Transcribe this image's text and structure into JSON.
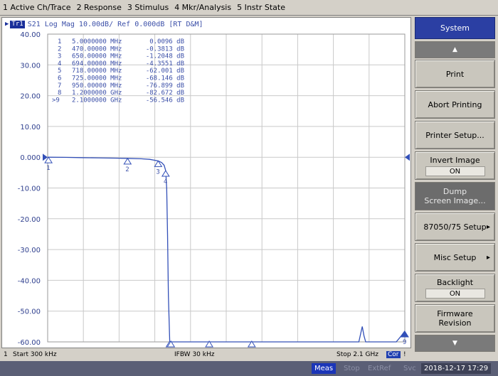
{
  "menu": [
    "1 Active Ch/Trace",
    "2 Response",
    "3 Stimulus",
    "4 Mkr/Analysis",
    "5 Instr State"
  ],
  "trace": {
    "badge": "Tr1",
    "header": "S21  Log Mag 10.00dB/ Ref 0.000dB [RT D&M]"
  },
  "chart_data": {
    "type": "line",
    "xlabel": "",
    "ylabel": "",
    "x_unit": "GHz",
    "xlim": [
      0.0003,
      2.1
    ],
    "ylim": [
      -60,
      40
    ],
    "yticks": [
      "40.00",
      "30.00",
      "20.00",
      "10.00",
      "0.000",
      "-10.00",
      "-20.00",
      "-30.00",
      "-40.00",
      "-50.00",
      "-60.00"
    ],
    "grid": true,
    "series": [
      {
        "x": [
          0.0003,
          0.005,
          0.1,
          0.2,
          0.3,
          0.4,
          0.47,
          0.55,
          0.6,
          0.65,
          0.67,
          0.685,
          0.694,
          0.7,
          0.705,
          0.71,
          0.718,
          0.725,
          0.73,
          0.735,
          0.95,
          1.2,
          1.5,
          1.7,
          1.8,
          1.83,
          1.85,
          1.86,
          1.87,
          1.9,
          2.0,
          2.05,
          2.08,
          2.1
        ],
        "y": [
          0.0,
          0.0,
          -0.05,
          -0.15,
          -0.2,
          -0.3,
          -0.38,
          -0.5,
          -0.7,
          -1.2,
          -1.7,
          -2.6,
          -4.36,
          -10,
          -25,
          -45,
          -62.0,
          -68.1,
          -70,
          -70,
          -76.9,
          -82.7,
          -80,
          -78,
          -72,
          -63,
          -55,
          -58,
          -70,
          -65,
          -61,
          -60,
          -58,
          -56.5
        ]
      }
    ],
    "markers": [
      {
        "n": "1",
        "active": false,
        "freq": "5.0000000 MHz",
        "val": "0.0096 dB",
        "x": 0.005,
        "y": 0.0096
      },
      {
        "n": "2",
        "active": false,
        "freq": "470.00000 MHz",
        "val": "-0.3813 dB",
        "x": 0.47,
        "y": -0.3813
      },
      {
        "n": "3",
        "active": false,
        "freq": "650.00000 MHz",
        "val": "-1.2048 dB",
        "x": 0.65,
        "y": -1.2048
      },
      {
        "n": "4",
        "active": false,
        "freq": "694.00000 MHz",
        "val": "-4.3551 dB",
        "x": 0.694,
        "y": -4.3551
      },
      {
        "n": "5",
        "active": false,
        "freq": "718.00000 MHz",
        "val": "-62.001 dB",
        "x": 0.718,
        "y": -62.001
      },
      {
        "n": "6",
        "active": false,
        "freq": "725.00000 MHz",
        "val": "-68.146 dB",
        "x": 0.725,
        "y": -68.146
      },
      {
        "n": "7",
        "active": false,
        "freq": "950.00000 MHz",
        "val": "-76.899 dB",
        "x": 0.95,
        "y": -76.899
      },
      {
        "n": "8",
        "active": false,
        "freq": "1.2000000 GHz",
        "val": "-82.672 dB",
        "x": 1.2,
        "y": -82.672
      },
      {
        "n": "9",
        "active": true,
        "freq": "2.1000000 GHz",
        "val": "-56.546 dB",
        "x": 2.1,
        "y": -56.546
      }
    ]
  },
  "status": {
    "channel": "1",
    "start": "Start 300 kHz",
    "ifbw": "IFBW 30 kHz",
    "stop": "Stop 2.1 GHz",
    "cor": "Cor",
    "end": "!"
  },
  "softkeys": {
    "title": "System",
    "print": "Print",
    "abort": "Abort Printing",
    "printer_setup": "Printer Setup...",
    "invert_label": "Invert Image",
    "invert_value": "ON",
    "dump_line1": "Dump",
    "dump_line2": "Screen Image...",
    "setup_87050": "87050/75 Setup",
    "misc": "Misc Setup",
    "backlight_label": "Backlight",
    "backlight_value": "ON",
    "firmware_line1": "Firmware",
    "firmware_line2": "Revision"
  },
  "bottombar": {
    "meas": "Meas",
    "stop": "Stop",
    "extref": "ExtRef",
    "svc": "Svc",
    "clock": "2018-12-17 17:29"
  },
  "colors": {
    "trace": "#3350b8",
    "grid": "#c9c9c9",
    "active_softkey": "#2b3fa3",
    "meas_badge": "#1b35b8"
  }
}
